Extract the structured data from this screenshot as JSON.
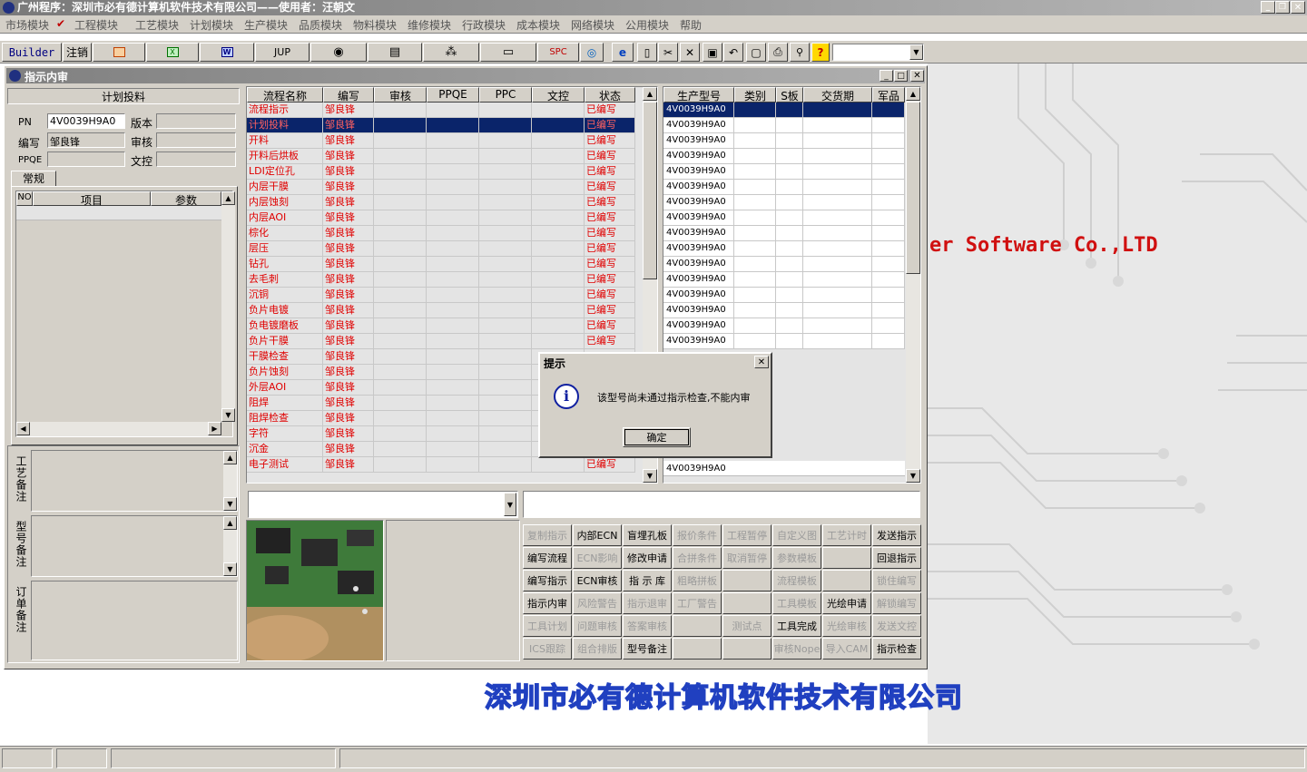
{
  "app_title": "广州程序：深圳市必有德计算机软件技术有限公司——使用者：汪朝文",
  "menu": [
    "市场模块",
    "工程模块",
    "工艺模块",
    "计划模块",
    "生产模块",
    "品质模块",
    "物料模块",
    "维修模块",
    "行政模块",
    "成本模块",
    "网络模块",
    "公用模块",
    "帮助"
  ],
  "toolbar": {
    "builder": "Builder",
    "logout": "注销",
    "jup": "JUP",
    "spc": "SPC"
  },
  "window": {
    "title": "指示内审"
  },
  "left": {
    "section_title": "计划投料",
    "pn_label": "PN",
    "pn_value": "4V0039H9A0",
    "version_label": "版本",
    "version_value": "",
    "author_label": "编写",
    "author_value": "邹良锋",
    "review_label": "审核",
    "review_value": "",
    "ppqe_label": "PPQE",
    "ppqe_value": "",
    "doc_label": "文控",
    "doc_value": "",
    "tab": "常规",
    "param_headers": [
      "NO",
      "项目",
      "参数"
    ],
    "notes": [
      "工艺备注",
      "型号备注",
      "订单备注"
    ]
  },
  "flow_table": {
    "headers": [
      "流程名称",
      "编写",
      "审核",
      "PPQE",
      "PPC",
      "文控",
      "状态"
    ],
    "rows": [
      [
        "流程指示",
        "邹良锋",
        "已编写"
      ],
      [
        "计划投料",
        "邹良锋",
        "已编写"
      ],
      [
        "开料",
        "邹良锋",
        "已编写"
      ],
      [
        "开料后烘板",
        "邹良锋",
        "已编写"
      ],
      [
        "LDI定位孔",
        "邹良锋",
        "已编写"
      ],
      [
        "内层干膜",
        "邹良锋",
        "已编写"
      ],
      [
        "内层蚀刻",
        "邹良锋",
        "已编写"
      ],
      [
        "内层AOI",
        "邹良锋",
        "已编写"
      ],
      [
        "棕化",
        "邹良锋",
        "已编写"
      ],
      [
        "层压",
        "邹良锋",
        "已编写"
      ],
      [
        "钻孔",
        "邹良锋",
        "已编写"
      ],
      [
        "去毛刺",
        "邹良锋",
        "已编写"
      ],
      [
        "沉铜",
        "邹良锋",
        "已编写"
      ],
      [
        "负片电镀",
        "邹良锋",
        "已编写"
      ],
      [
        "负电镀磨板",
        "邹良锋",
        "已编写"
      ],
      [
        "负片干膜",
        "邹良锋",
        "已编写"
      ],
      [
        "干膜检查",
        "邹良锋",
        ""
      ],
      [
        "负片蚀刻",
        "邹良锋",
        ""
      ],
      [
        "外层AOI",
        "邹良锋",
        ""
      ],
      [
        "阻焊",
        "邹良锋",
        ""
      ],
      [
        "阻焊检查",
        "邹良锋",
        ""
      ],
      [
        "字符",
        "邹良锋",
        ""
      ],
      [
        "沉金",
        "邹良锋",
        ""
      ],
      [
        "电子测试",
        "邹良锋",
        "已编写"
      ]
    ],
    "selected_row": 1
  },
  "model_table": {
    "headers": [
      "生产型号",
      "类别",
      "S板",
      "交货期",
      "军品"
    ],
    "rows": [
      "4V0039H9A0",
      "4V0039H9A0",
      "4V0039H9A0",
      "4V0039H9A0",
      "4V0039H9A0",
      "4V0039H9A0",
      "4V0039H9A0",
      "4V0039H9A0",
      "4V0039H9A0",
      "4V0039H9A0",
      "4V0039H9A0",
      "4V0039H9A0",
      "4V0039H9A0",
      "4V0039H9A0",
      "4V0039H9A0",
      "4V0039H9A0"
    ],
    "last_row": "4V0039H9A0"
  },
  "action_buttons": [
    [
      "复制指示",
      "内部ECN",
      "盲埋孔板",
      "报价条件",
      "工程暂停",
      "自定义图",
      "工艺计时",
      "发送指示"
    ],
    [
      "编写流程",
      "ECN影响",
      "修改申请",
      "合拼条件",
      "取消暂停",
      "参数模板",
      "",
      "回退指示"
    ],
    [
      "编写指示",
      "ECN审核",
      "指 示 库",
      "粗略拼板",
      "",
      "流程模板",
      "",
      "锁住编写"
    ],
    [
      "指示内审",
      "风险警告",
      "指示退审",
      "工厂警告",
      "",
      "工具模板",
      "光绘申请",
      "解锁编写"
    ],
    [
      "工具计划",
      "问题审核",
      "答案审核",
      "",
      "测试点",
      "工具完成",
      "光绘审核",
      "发送文控"
    ],
    [
      "ICS跟踪",
      "组合排版",
      "型号备注",
      "",
      "",
      "审核Nope",
      "导入CAM",
      "指示检查"
    ]
  ],
  "action_enabled": [
    [
      false,
      true,
      true,
      false,
      false,
      false,
      false,
      true
    ],
    [
      true,
      false,
      true,
      false,
      false,
      false,
      false,
      true
    ],
    [
      true,
      true,
      true,
      false,
      false,
      false,
      false,
      false
    ],
    [
      true,
      false,
      false,
      false,
      false,
      false,
      true,
      false
    ],
    [
      false,
      false,
      false,
      false,
      false,
      true,
      false,
      false
    ],
    [
      false,
      false,
      true,
      false,
      false,
      false,
      false,
      true
    ]
  ],
  "dialog": {
    "title": "提示",
    "message": "该型号尚未通过指示检查,不能内审",
    "ok": "确定"
  },
  "background": {
    "slogan_en": "er Software Co.,LTD",
    "slogan_cn": "深圳市必有德计算机软件技术有限公司"
  },
  "colors": {
    "selection": "#0a246a",
    "status_red": "#e00000",
    "titlebar": "#8a8a8a",
    "slogan_red": "#d01010",
    "slogan_blue": "#2040c0"
  }
}
